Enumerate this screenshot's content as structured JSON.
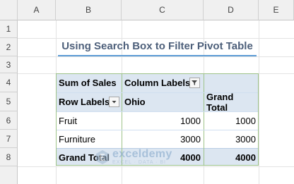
{
  "columns": [
    "A",
    "B",
    "C",
    "D",
    "E"
  ],
  "rows": [
    "1",
    "2",
    "3",
    "4",
    "5",
    "6",
    "7",
    "8"
  ],
  "title": "Using Search Box to Filter Pivot Table",
  "pivot": {
    "sum_of_sales": "Sum of Sales",
    "column_labels": "Column Labels",
    "row_labels": "Row Labels",
    "col_ohio": "Ohio",
    "col_grand_total": "Grand Total",
    "data_rows": [
      {
        "label": "Fruit",
        "ohio": "1000",
        "grand_total": "1000"
      },
      {
        "label": "Furniture",
        "ohio": "3000",
        "grand_total": "3000"
      }
    ],
    "total_row": {
      "label": "Grand Total",
      "ohio": "4000",
      "grand_total": "4000"
    }
  },
  "watermark": {
    "name": "exceldemy",
    "tagline": "EXCEL · DATA · BI"
  },
  "colors": {
    "header_fill": "#dce6f1",
    "title_text": "#4d5f7a",
    "title_underline": "#5b9bd5"
  }
}
